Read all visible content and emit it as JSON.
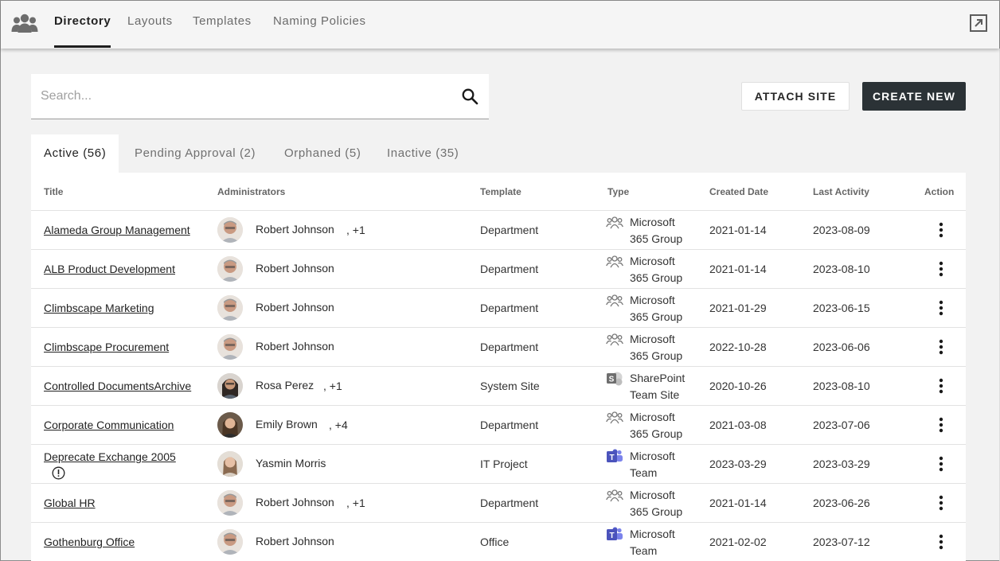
{
  "nav": {
    "tabs": [
      "Directory",
      "Layouts",
      "Templates",
      "Naming Policies"
    ],
    "active_tab": "Directory"
  },
  "search": {
    "placeholder": "Search..."
  },
  "actions": {
    "attach_site": "ATTACH SITE",
    "create_new": "CREATE NEW"
  },
  "status_tabs": [
    "Active (56)",
    "Pending Approval (2)",
    "Orphaned (5)",
    "Inactive (35)"
  ],
  "table": {
    "headers": [
      "Title",
      "Administrators",
      "Template",
      "Type",
      "Created Date",
      "Last Activity",
      "Action"
    ],
    "rows": [
      {
        "title": "Alameda Group Management",
        "admin": "Robert Johnson",
        "extra": ", +1",
        "template": "Department",
        "type_line1": "Microsoft",
        "type_line2": "365 Group",
        "type_icon": "group-icon",
        "created": "2021-01-14",
        "last": "2023-08-09"
      },
      {
        "title": "ALB Product Development",
        "admin": "Robert Johnson",
        "extra": "",
        "template": "Department",
        "type_line1": "Microsoft",
        "type_line2": "365 Group",
        "type_icon": "group-icon",
        "created": "2021-01-14",
        "last": "2023-08-10"
      },
      {
        "title": "Climbscape Marketing",
        "admin": "Robert Johnson",
        "extra": "",
        "template": "Department",
        "type_line1": "Microsoft",
        "type_line2": "365 Group",
        "type_icon": "group-icon",
        "created": "2021-01-29",
        "last": "2023-06-15"
      },
      {
        "title": "Climbscape Procurement",
        "admin": "Robert Johnson",
        "extra": "",
        "template": "Department",
        "type_line1": "Microsoft",
        "type_line2": "365 Group",
        "type_icon": "group-icon",
        "created": "2022-10-28",
        "last": "2023-06-06"
      },
      {
        "title_line1": "Controlled Documents",
        "title_line2": "Archive",
        "admin": "Rosa Perez",
        "extra": ", +1",
        "template": "System Site",
        "type_line1": "SharePoint",
        "type_line2": "Team Site",
        "type_icon": "sharepoint-icon",
        "created": "2020-10-26",
        "last": "2023-08-10"
      },
      {
        "title": "Corporate Communication",
        "admin": "Emily Brown",
        "extra": ", +4",
        "template": "Department",
        "type_line1": "Microsoft",
        "type_line2": "365 Group",
        "type_icon": "group-icon",
        "created": "2021-03-08",
        "last": "2023-07-06"
      },
      {
        "title": "Deprecate Exchange 2005",
        "warning": true,
        "admin": "Yasmin Morris",
        "extra": "",
        "template": "IT Project",
        "type_line1": "Microsoft",
        "type_line2": "Team",
        "type_icon": "teams-icon",
        "created": "2023-03-29",
        "last": "2023-03-29"
      },
      {
        "title": "Global HR",
        "admin": "Robert Johnson",
        "extra": ", +1",
        "template": "Department",
        "type_line1": "Microsoft",
        "type_line2": "365 Group",
        "type_icon": "group-icon",
        "created": "2021-01-14",
        "last": "2023-06-26"
      },
      {
        "title": "Gothenburg Office",
        "admin": "Robert Johnson",
        "extra": "",
        "template": "Office",
        "type_line1": "Microsoft",
        "type_line2": "Team",
        "type_icon": "teams-icon",
        "created": "2021-02-02",
        "last": "2023-07-12"
      }
    ]
  }
}
